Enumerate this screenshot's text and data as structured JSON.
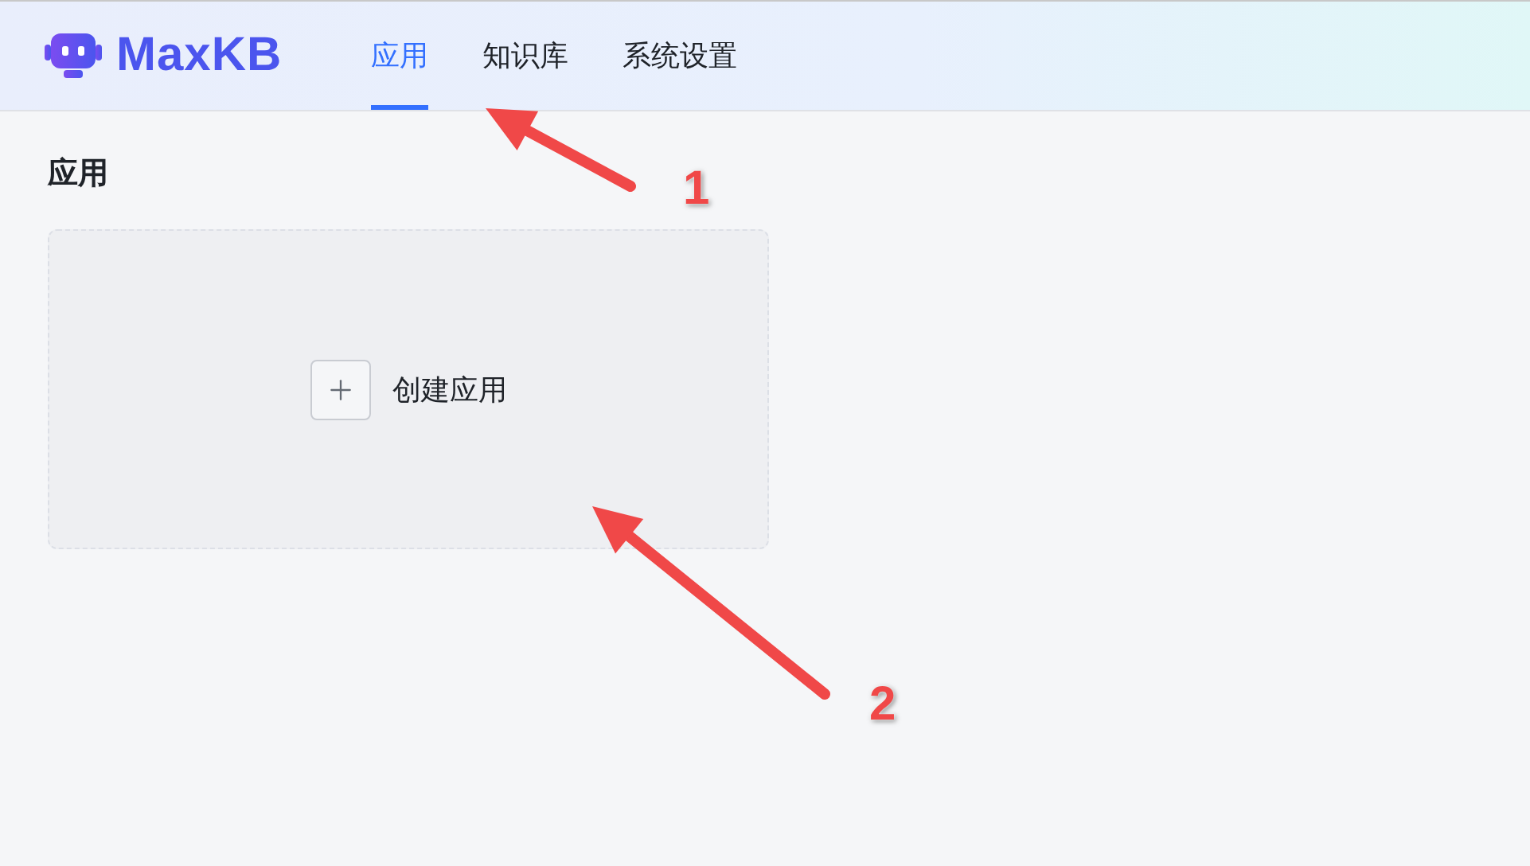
{
  "header": {
    "logo_text": "MaxKB",
    "tabs": [
      {
        "label": "应用",
        "selected": true
      },
      {
        "label": "知识库",
        "selected": false
      },
      {
        "label": "系统设置",
        "selected": false
      }
    ]
  },
  "page_title": "应用",
  "create_card": {
    "label": "创建应用"
  },
  "annotations": [
    {
      "label": "1"
    },
    {
      "label": "2"
    }
  ]
}
